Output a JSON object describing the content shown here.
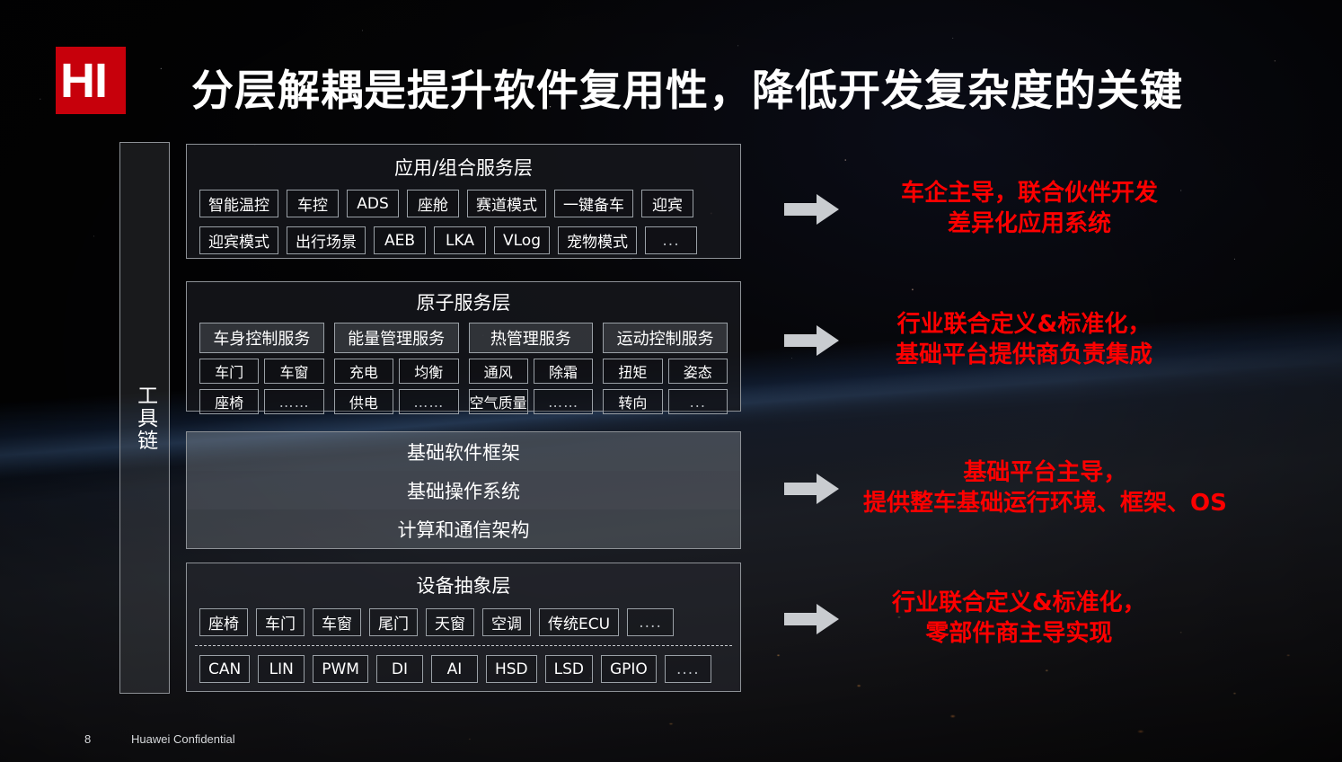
{
  "slide": {
    "title": "分层解耦是提升软件复用性，降低开发复杂度的关键",
    "logo_text": "HI",
    "accent_red": "#c7000b",
    "annotation_red": "#fe0000",
    "border_gray": "#8d9196"
  },
  "toolchain": {
    "label": "工具链"
  },
  "layers": {
    "application": {
      "title": "应用/组合服务层",
      "row1": [
        "智能温控",
        "车控",
        "ADS",
        "座舱",
        "赛道模式",
        "一键备车",
        "迎宾"
      ],
      "row2": [
        "迎宾模式",
        "出行场景",
        "AEB",
        "LKA",
        "VLog",
        "宠物模式",
        "..."
      ]
    },
    "atomic": {
      "title": "原子服务层",
      "groups": [
        {
          "head": "车身控制服务",
          "items": [
            "车门",
            "车窗",
            "座椅",
            "……"
          ]
        },
        {
          "head": "能量管理服务",
          "items": [
            "充电",
            "均衡",
            "供电",
            "……"
          ]
        },
        {
          "head": "热管理服务",
          "items": [
            "通风",
            "除霜",
            "空气质量",
            "……"
          ]
        },
        {
          "head": "运动控制服务",
          "items": [
            "扭矩",
            "姿态",
            "转向",
            "..."
          ]
        }
      ]
    },
    "foundation": {
      "bands": [
        "基础软件框架",
        "基础操作系统",
        "计算和通信架构"
      ]
    },
    "device": {
      "title": "设备抽象层",
      "devices": [
        "座椅",
        "车门",
        "车窗",
        "尾门",
        "天窗",
        "空调",
        "传统ECU",
        "...."
      ],
      "buses": [
        "CAN",
        "LIN",
        "PWM",
        "DI",
        "AI",
        "HSD",
        "LSD",
        "GPIO",
        "...."
      ]
    }
  },
  "annotations": [
    {
      "line1": "车企主导，联合伙伴开发",
      "line2": "差异化应用系统"
    },
    {
      "line1": "行业联合定义&标准化，",
      "line2": "基础平台提供商负责集成"
    },
    {
      "line1": "基础平台主导，",
      "line2": "提供整车基础运行环境、框架、OS"
    },
    {
      "line1": "行业联合定义&标准化，",
      "line2": "零部件商主导实现"
    }
  ],
  "footer": {
    "page_number": "8",
    "confidentiality": "Huawei Confidential"
  }
}
